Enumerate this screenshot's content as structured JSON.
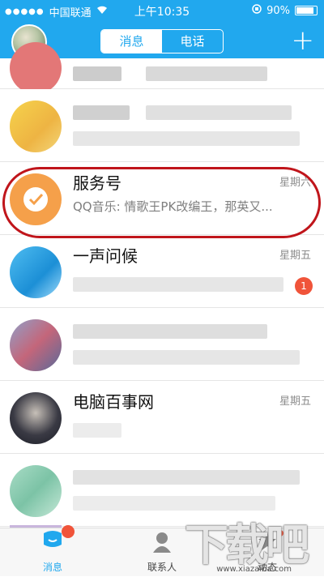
{
  "status_bar": {
    "carrier": "中国联通",
    "time": "上午10:35",
    "battery": "90%",
    "battery_level": 0.9
  },
  "nav": {
    "tab_messages": "消息",
    "tab_calls": "电话",
    "plus": "+"
  },
  "chats": [
    {
      "name": "",
      "time": "",
      "preview": ""
    },
    {
      "name": "",
      "time": "",
      "preview": ""
    },
    {
      "name": "服务号",
      "time": "星期六",
      "preview": "QQ音乐: 情歌王PK改编王，那英又..."
    },
    {
      "name": "一声问候",
      "time": "星期五",
      "preview": "",
      "badge": "1"
    },
    {
      "name": "",
      "time": "",
      "preview": ""
    },
    {
      "name": "电脑百事网",
      "time": "星期五",
      "preview": ""
    },
    {
      "name": "",
      "time": "",
      "preview": ""
    }
  ],
  "tabbar": {
    "messages": "消息",
    "contacts": "联系人",
    "activity": "动态"
  },
  "watermark": {
    "logo": "下载吧",
    "url": "www.xiazaiba.com"
  },
  "colors": {
    "brand": "#21a8ee",
    "badge": "#f0543a",
    "highlight": "#c0151b",
    "service_icon": "#f5a04a"
  }
}
